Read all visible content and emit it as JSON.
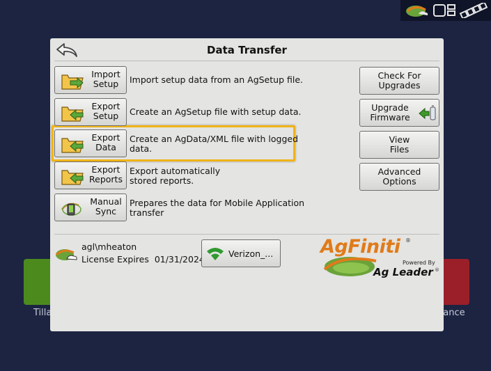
{
  "status_bar": {
    "icons": [
      "field-status-icon",
      "device-status-icon",
      "satellite-icon"
    ]
  },
  "background": {
    "left_tile_label": "Tilla",
    "right_tile_label": "dance"
  },
  "dialog": {
    "title": "Data Transfer",
    "left_buttons": [
      {
        "label_line1": "Import",
        "label_line2": "Setup",
        "description": "Import setup data from an AgSetup file.",
        "icon": "folder-arrow-in-icon"
      },
      {
        "label_line1": "Export",
        "label_line2": "Setup",
        "description": "Create an AgSetup file with setup data.",
        "icon": "folder-arrow-out-icon"
      },
      {
        "label_line1": "Export",
        "label_line2": "Data",
        "description_line1": "Create an AgData/XML file with logged",
        "description_line2": "data.",
        "icon": "folder-arrow-out-icon",
        "highlighted": true
      },
      {
        "label_line1": "Export",
        "label_line2": "Reports",
        "description_line1": "Export automatically",
        "description_line2": "stored reports.",
        "icon": "folder-arrow-out-icon"
      },
      {
        "label_line1": "Manual",
        "label_line2": "Sync",
        "description_line1": "Prepares the data for Mobile Application",
        "description_line2": "transfer",
        "icon": "mobile-sync-icon"
      }
    ],
    "right_buttons": [
      {
        "label_line1": "Check For",
        "label_line2": "Upgrades"
      },
      {
        "label_line1": "Upgrade",
        "label_line2": "Firmware",
        "icon": "firmware-upgrade-icon"
      },
      {
        "label_line1": "View",
        "label_line2": "Files"
      },
      {
        "label_line1": "Advanced",
        "label_line2": "Options"
      }
    ],
    "account": {
      "user": "agl\\mheaton",
      "license_label": "License Expires",
      "license_date": "01/31/2024",
      "license_text": "License Expires  01/31/2024"
    },
    "network": {
      "label": "Verizon_...",
      "icon": "wifi-icon"
    },
    "logo": {
      "name": "AgFiniti",
      "reg_mark": "®",
      "powered_by": "Powered By",
      "company": "Ag Leader",
      "company_reg": "®"
    }
  },
  "colors": {
    "background": "#1c2442",
    "dialog": "#e4e4e2",
    "highlight": "#f0b418",
    "brand_orange": "#e07b1a",
    "brand_green": "#4c8a1e"
  }
}
